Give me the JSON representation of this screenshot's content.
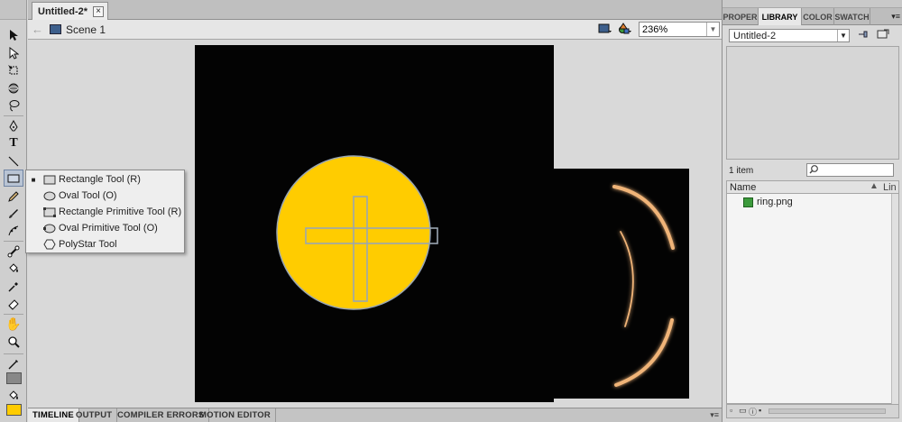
{
  "document": {
    "tab_title": "Untitled-2*",
    "close_glyph": "×"
  },
  "editbar": {
    "back_glyph": "←",
    "scene_label": "Scene 1",
    "zoom_value": "236%"
  },
  "tools": [
    {
      "name": "selection-tool",
      "icon": "selection-arrow-icon"
    },
    {
      "name": "subselection-tool",
      "icon": "subselection-arrow-icon"
    },
    {
      "name": "free-transform-tool",
      "icon": "free-transform-icon"
    },
    {
      "name": "3d-rotation-tool",
      "icon": "3d-rotation-icon"
    },
    {
      "name": "lasso-tool",
      "icon": "lasso-icon"
    },
    {
      "name": "pen-tool",
      "icon": "pen-icon"
    },
    {
      "name": "text-tool",
      "icon": "text-icon"
    },
    {
      "name": "line-tool",
      "icon": "line-icon"
    },
    {
      "name": "rectangle-tool",
      "icon": "rectangle-icon"
    },
    {
      "name": "pencil-tool",
      "icon": "pencil-icon"
    },
    {
      "name": "brush-tool",
      "icon": "brush-icon"
    },
    {
      "name": "deco-tool",
      "icon": "deco-icon"
    },
    {
      "name": "bone-tool",
      "icon": "bone-icon"
    },
    {
      "name": "paint-bucket-tool",
      "icon": "paint-bucket-icon"
    },
    {
      "name": "eyedropper-tool",
      "icon": "eyedropper-icon"
    },
    {
      "name": "eraser-tool",
      "icon": "eraser-icon"
    },
    {
      "name": "hand-tool",
      "icon": "hand-icon"
    },
    {
      "name": "zoom-tool",
      "icon": "zoom-icon"
    }
  ],
  "colors": {
    "stroke_color": "#888888",
    "fill_color": "#ffcc00",
    "stage_color": "#030303",
    "circle_fill": "#ffcc00",
    "circle_stroke": "#9aa6b2",
    "ring_glow": "#f0b478"
  },
  "flyout": {
    "items": [
      {
        "label": "Rectangle Tool (R)",
        "icon": "rectangle-icon",
        "selected": true
      },
      {
        "label": "Oval Tool (O)",
        "icon": "oval-icon",
        "selected": false
      },
      {
        "label": "Rectangle Primitive Tool (R)",
        "icon": "rectangle-primitive-icon",
        "selected": false
      },
      {
        "label": "Oval Primitive Tool (O)",
        "icon": "oval-primitive-icon",
        "selected": false
      },
      {
        "label": "PolyStar Tool",
        "icon": "polystar-icon",
        "selected": false
      }
    ],
    "selected_mark": "■"
  },
  "bottom_tabs": [
    {
      "label": "TIMELINE",
      "active": true
    },
    {
      "label": "OUTPUT",
      "active": false
    },
    {
      "label": "COMPILER ERRORS",
      "active": false
    },
    {
      "label": "MOTION EDITOR",
      "active": false
    }
  ],
  "right_panel": {
    "tabs": [
      {
        "label": "PROPER",
        "active": false
      },
      {
        "label": "LIBRARY",
        "active": true
      },
      {
        "label": "COLOR",
        "active": false
      },
      {
        "label": "SWATCH",
        "active": false
      }
    ],
    "library": {
      "document_select": "Untitled-2",
      "item_count": "1 item",
      "search_placeholder": "",
      "col_name": "Name",
      "col_linkage": "Lin",
      "items": [
        {
          "name": "ring.png",
          "icon": "bitmap-icon"
        }
      ]
    }
  }
}
